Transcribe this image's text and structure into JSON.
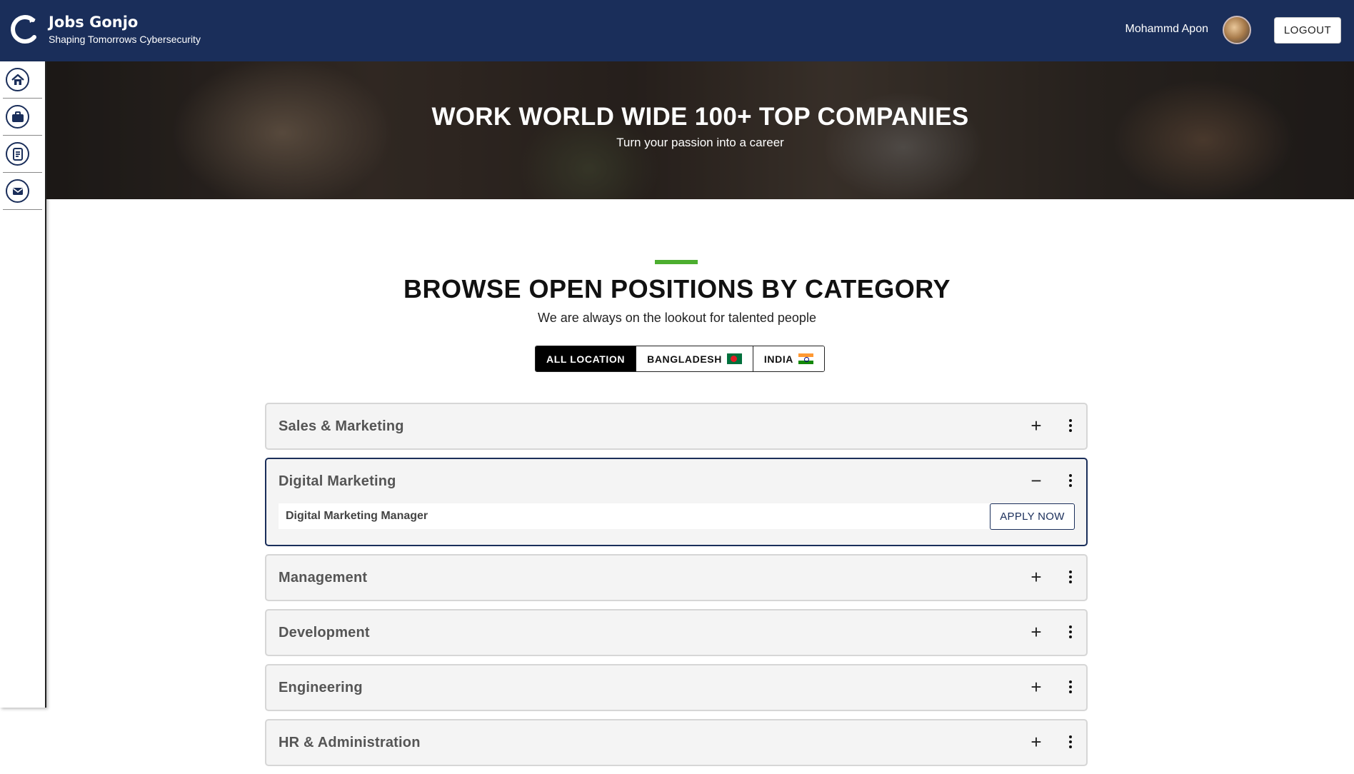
{
  "header": {
    "title": "Jobs Gonjo",
    "subtitle": "Shaping Tomorrows Cybersecurity",
    "user_name": "Mohammd Apon",
    "logout_label": "LOGOUT",
    "bg_color": "#1a2e5a"
  },
  "sidebar": {
    "items": [
      {
        "icon": "home-icon"
      },
      {
        "icon": "briefcase-icon"
      },
      {
        "icon": "document-list-icon"
      },
      {
        "icon": "mail-icon"
      }
    ]
  },
  "hero": {
    "title": "WORK WORLD WIDE 100+ TOP COMPANIES",
    "subtitle": "Turn your passion into a career"
  },
  "section": {
    "title": "BROWSE OPEN POSITIONS BY CATEGORY",
    "subtitle": "We are always on the lookout for talented people",
    "accent_color": "#4cae2f"
  },
  "locations": {
    "all_label": "ALL LOCATION",
    "bangladesh_label": "BANGLADESH",
    "india_label": "INDIA",
    "selected": "ALL LOCATION"
  },
  "categories": [
    {
      "name": "Sales & Marketing",
      "expanded": false
    },
    {
      "name": "Digital Marketing",
      "expanded": true,
      "jobs": [
        {
          "title": "Digital Marketing Manager",
          "action": "APPLY NOW"
        }
      ]
    },
    {
      "name": "Management",
      "expanded": false
    },
    {
      "name": "Development",
      "expanded": false
    },
    {
      "name": "Engineering",
      "expanded": false
    },
    {
      "name": "HR & Administration",
      "expanded": false
    }
  ],
  "toggle_symbols": {
    "expand": "+",
    "collapse": "−"
  }
}
